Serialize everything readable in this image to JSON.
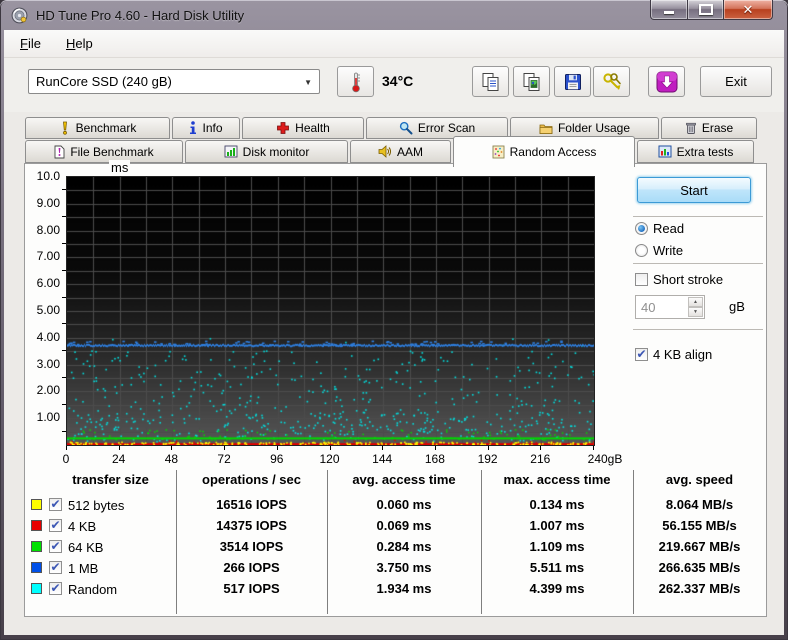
{
  "window": {
    "title": "HD Tune Pro 4.60 - Hard Disk Utility",
    "controls": {
      "minimize": "minimize",
      "maximize": "maximize",
      "close": "✕"
    }
  },
  "menu": {
    "items": [
      {
        "label": "File"
      },
      {
        "label": "Help"
      }
    ]
  },
  "toolbar": {
    "drive_select": "RunCore SSD (240 gB)",
    "temperature": "34°C",
    "exit_label": "Exit",
    "icons": [
      "thermometer-icon",
      "copy-text-icon",
      "copy-image-icon",
      "save-icon",
      "options-icon",
      "update-icon"
    ]
  },
  "tabs": {
    "active": "Random Access",
    "row1": [
      {
        "label": "Benchmark",
        "icon": "exclamation-icon"
      },
      {
        "label": "Info",
        "icon": "info-icon"
      },
      {
        "label": "Health",
        "icon": "red-cross-icon"
      },
      {
        "label": "Error Scan",
        "icon": "magnifier-icon"
      },
      {
        "label": "Folder Usage",
        "icon": "folder-icon"
      },
      {
        "label": "Erase",
        "icon": "trash-icon"
      }
    ],
    "row2": [
      {
        "label": "File Benchmark",
        "icon": "file-exclamation-icon"
      },
      {
        "label": "Disk monitor",
        "icon": "bar-chart-icon"
      },
      {
        "label": "AAM",
        "icon": "speaker-icon"
      },
      {
        "label": "Random Access",
        "icon": "dotted-page-icon"
      },
      {
        "label": "Extra tests",
        "icon": "mini-chart-icon"
      }
    ]
  },
  "controls": {
    "start": "Start",
    "read": "Read",
    "read_selected": true,
    "write": "Write",
    "write_selected": false,
    "short_stroke": "Short stroke",
    "short_stroke_checked": false,
    "stroke_value": "40",
    "stroke_unit": "gB",
    "align": "4 KB align",
    "align_checked": true
  },
  "chart_data": {
    "type": "scatter",
    "title": "",
    "xlabel": "gB",
    "ylabel": "ms",
    "xlim": [
      0,
      240
    ],
    "ylim": [
      0,
      10
    ],
    "x_ticks": [
      0,
      24,
      48,
      72,
      96,
      120,
      144,
      168,
      192,
      216,
      240
    ],
    "x_tick_labels": [
      "0",
      "24",
      "48",
      "72",
      "96",
      "120",
      "144",
      "168",
      "192",
      "216",
      "240gB"
    ],
    "y_tick_labels": [
      "10.0",
      "9.00",
      "8.00",
      "7.00",
      "6.00",
      "5.00",
      "4.00",
      "3.00",
      "2.00",
      "1.00"
    ],
    "grid": {
      "on": true,
      "x_step_gb": 12,
      "y_step_ms": 0.5,
      "color": "#4c4c4c"
    },
    "background_gradient": [
      "#000000",
      "#0a0a0a",
      "#2e2e2e",
      "#565656"
    ],
    "legend_position": "table-below",
    "series": [
      {
        "name": "512 bytes",
        "color": "#ffff00",
        "style": "dots",
        "band_ms": [
          0.03,
          0.13
        ],
        "count": 240
      },
      {
        "name": "4 KB",
        "color": "#e00000",
        "style": "line",
        "avg_ms": 0.069,
        "thickness": 2,
        "scatter_band_ms": [
          0.05,
          0.2
        ],
        "scatter_count": 30
      },
      {
        "name": "64 KB",
        "color": "#00d800",
        "style": "line",
        "avg_ms": 0.284,
        "thickness": 2,
        "scatter_band_ms": [
          0.2,
          0.6
        ],
        "scatter_count": 90
      },
      {
        "name": "1 MB",
        "color": "#2e7fe0",
        "style": "line",
        "avg_ms": 3.75,
        "thickness": 2,
        "jitter_ms": 0.06,
        "scatter_band_ms": [
          3.76,
          3.9
        ],
        "scatter_count": 70
      },
      {
        "name": "Random",
        "color": "#00dede",
        "style": "dots",
        "band_ms": [
          0.15,
          3.55
        ],
        "count": 580,
        "low_bias": 0.3,
        "above_band_ms": [
          3.6,
          4.0
        ],
        "above_count": 7
      }
    ]
  },
  "results_table": {
    "headers": [
      "transfer size",
      "operations / sec",
      "avg. access time",
      "max. access time",
      "avg. speed"
    ],
    "rows": [
      {
        "color": "#ffff00",
        "checked": true,
        "label": "512 bytes",
        "ops": "16516 IOPS",
        "avg": "0.060 ms",
        "max": "0.134 ms",
        "speed": "8.064 MB/s"
      },
      {
        "color": "#e80000",
        "checked": true,
        "label": "4 KB",
        "ops": "14375 IOPS",
        "avg": "0.069 ms",
        "max": "1.007 ms",
        "speed": "56.155 MB/s"
      },
      {
        "color": "#00e000",
        "checked": true,
        "label": "64 KB",
        "ops": "3514 IOPS",
        "avg": "0.284 ms",
        "max": "1.109 ms",
        "speed": "219.667 MB/s"
      },
      {
        "color": "#0050e8",
        "checked": true,
        "label": "1 MB",
        "ops": "266 IOPS",
        "avg": "3.750 ms",
        "max": "5.511 ms",
        "speed": "266.635 MB/s"
      },
      {
        "color": "#00ffff",
        "checked": true,
        "label": "Random",
        "ops": "517 IOPS",
        "avg": "1.934 ms",
        "max": "4.399 ms",
        "speed": "262.337 MB/s"
      }
    ]
  }
}
